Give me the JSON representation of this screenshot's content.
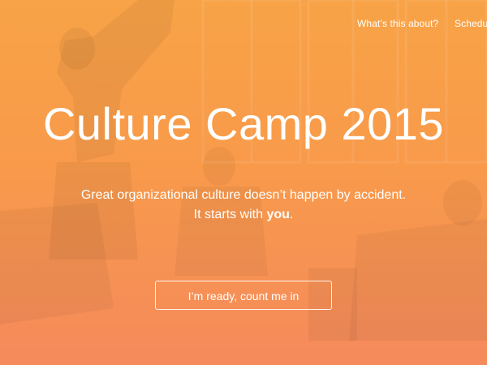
{
  "nav": {
    "items": [
      {
        "label": "What’s this about?"
      },
      {
        "label": "Schedule"
      }
    ]
  },
  "hero": {
    "title": "Culture Camp 2015",
    "subtitle_line1": "Great organizational culture doesn’t happen by accident.",
    "subtitle_line2_prefix": "It starts with ",
    "subtitle_line2_emphasis": "you",
    "subtitle_line2_suffix": ".",
    "cta_label": "I’m ready, count me in"
  },
  "colors": {
    "overlay_top": "#f8a347",
    "overlay_bottom": "#f58a5c",
    "text": "#ffffff"
  }
}
